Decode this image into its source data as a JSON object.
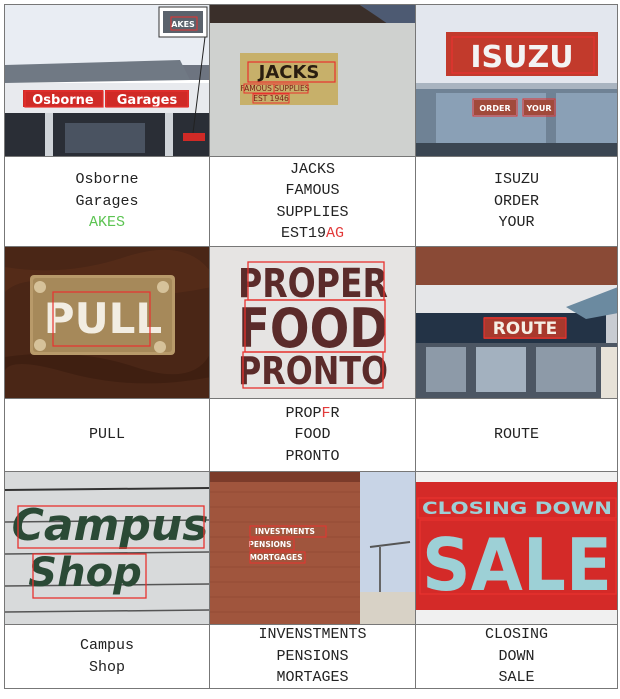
{
  "cells": [
    {
      "lines": [
        [
          {
            "t": "Osborne"
          }
        ],
        [
          {
            "t": "Garages"
          }
        ],
        [
          {
            "t": "AKES",
            "c": "ok"
          }
        ]
      ]
    },
    {
      "lines": [
        [
          {
            "t": "JACKS"
          }
        ],
        [
          {
            "t": "FAMOUS"
          }
        ],
        [
          {
            "t": "SUPPLIES"
          }
        ],
        [
          {
            "t": "EST19"
          },
          {
            "t": "AG",
            "c": "err"
          }
        ]
      ]
    },
    {
      "lines": [
        [
          {
            "t": "ISUZU"
          }
        ],
        [
          {
            "t": "ORDER"
          }
        ],
        [
          {
            "t": "YOUR"
          }
        ]
      ]
    },
    {
      "lines": [
        [
          {
            "t": "PULL"
          }
        ]
      ]
    },
    {
      "lines": [
        [
          {
            "t": "PROP"
          },
          {
            "t": "F",
            "c": "err"
          },
          {
            "t": "R"
          }
        ],
        [
          {
            "t": "FOOD"
          }
        ],
        [
          {
            "t": "PRONTO"
          }
        ]
      ]
    },
    {
      "lines": [
        [
          {
            "t": "ROUTE"
          }
        ]
      ]
    },
    {
      "lines": [
        [
          {
            "t": "Campus"
          }
        ],
        [
          {
            "t": "Shop"
          }
        ]
      ]
    },
    {
      "lines": [
        [
          {
            "t": "INVENSTMENTS"
          }
        ],
        [
          {
            "t": "PENSIONS"
          }
        ],
        [
          {
            "t": "MORTAGES"
          }
        ]
      ]
    },
    {
      "lines": [
        [
          {
            "t": "CLOSING"
          }
        ],
        [
          {
            "t": "DOWN"
          }
        ],
        [
          {
            "t": "SALE"
          }
        ]
      ]
    }
  ],
  "signs": {
    "osborne": {
      "words": [
        "Osborne",
        "Garages"
      ],
      "inset": "AKES"
    },
    "jacks": {
      "lines": [
        "JACKS",
        "FAMOUS SUPPLIES",
        "EST 1946"
      ]
    },
    "isuzu": {
      "brand": "ISUZU",
      "window": [
        "ORDER",
        "YOUR"
      ]
    },
    "pull": {
      "word": "PULL"
    },
    "proper": {
      "lines": [
        "PROPER",
        "FOOD",
        "PRONTO"
      ]
    },
    "route": {
      "word": "ROUTE"
    },
    "campus": {
      "lines": [
        "Campus",
        "Shop"
      ]
    },
    "investments": {
      "lines": [
        "INVESTMENTS",
        "PENSIONS",
        "MORTGAGES"
      ]
    },
    "sale": {
      "top": "CLOSING DOWN",
      "big": "SALE"
    }
  },
  "colors": {
    "box": "#e8322f",
    "correct": "#5cc452",
    "wrong": "#e23a3a",
    "grid": "#777777"
  }
}
